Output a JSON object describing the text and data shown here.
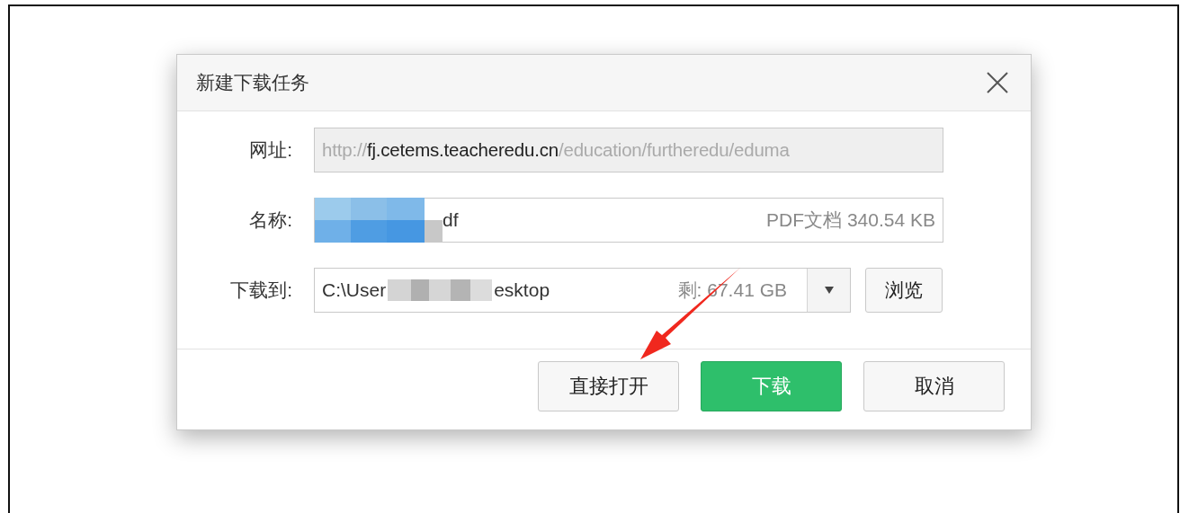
{
  "dialog": {
    "title": "新建下载任务"
  },
  "fields": [
    {
      "kind": "url",
      "label": "网址:",
      "disabled": true,
      "parts": [
        {
          "text": "http://",
          "emphasis": false
        },
        {
          "text": "fj.cetems.teacheredu.cn",
          "emphasis": true
        },
        {
          "text": "/education/furtheredu/eduma",
          "emphasis": false
        }
      ]
    },
    {
      "kind": "name",
      "label": "名称:",
      "redacted": true,
      "value": "df",
      "info": "PDF文档 340.54 KB"
    },
    {
      "kind": "path",
      "label": "下载到:",
      "redacted": true,
      "value_start": "C:\\User",
      "value_end": "esktop",
      "info": "剩: 67.41 GB",
      "button": "浏览"
    }
  ],
  "buttons": [
    {
      "label": "直接打开",
      "primary": false
    },
    {
      "label": "下载",
      "primary": true
    },
    {
      "label": "取消",
      "primary": false
    }
  ]
}
